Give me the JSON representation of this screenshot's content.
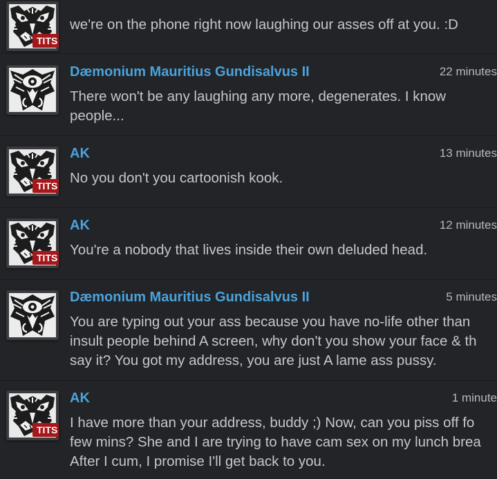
{
  "badge_label": "TITS",
  "colors": {
    "background": "#222427",
    "author": "#4ba3dc",
    "body_text": "#c5c7ca",
    "timestamp": "#b7b9bc",
    "badge": "#a5171a"
  },
  "messages": [
    {
      "author": "",
      "time": "",
      "avatar": "mask-avatar",
      "badge": true,
      "text": "we're on the phone right now laughing our asses off at you. :D"
    },
    {
      "author": "Dæmonium Mauritius Gundisalvus II",
      "time": "22 minutes",
      "avatar": "eye-avatar",
      "badge": false,
      "text": "There won't be any laughing any more, degenerates. I know\npeople..."
    },
    {
      "author": "AK",
      "time": "13 minutes",
      "avatar": "mask-avatar",
      "badge": true,
      "text": "No you don't you cartoonish kook."
    },
    {
      "author": "AK",
      "time": "12 minutes",
      "avatar": "mask-avatar",
      "badge": true,
      "text": "You're a nobody that lives inside their own deluded head."
    },
    {
      "author": "Dæmonium Mauritius Gundisalvus II",
      "time": "5 minutes",
      "avatar": "eye-avatar",
      "badge": false,
      "text": "You are typing out your ass because you have no-life other than\ninsult people behind A screen, why don't you show your face & th\nsay it? You got my address, you are just A lame ass pussy."
    },
    {
      "author": "AK",
      "time": "1 minute",
      "avatar": "mask-avatar",
      "badge": true,
      "text": "I have more than your address, buddy ;) Now, can you piss off fo\nfew mins? She and I are trying to have cam sex on my lunch brea\nAfter I cum, I promise I'll get back to you."
    }
  ]
}
